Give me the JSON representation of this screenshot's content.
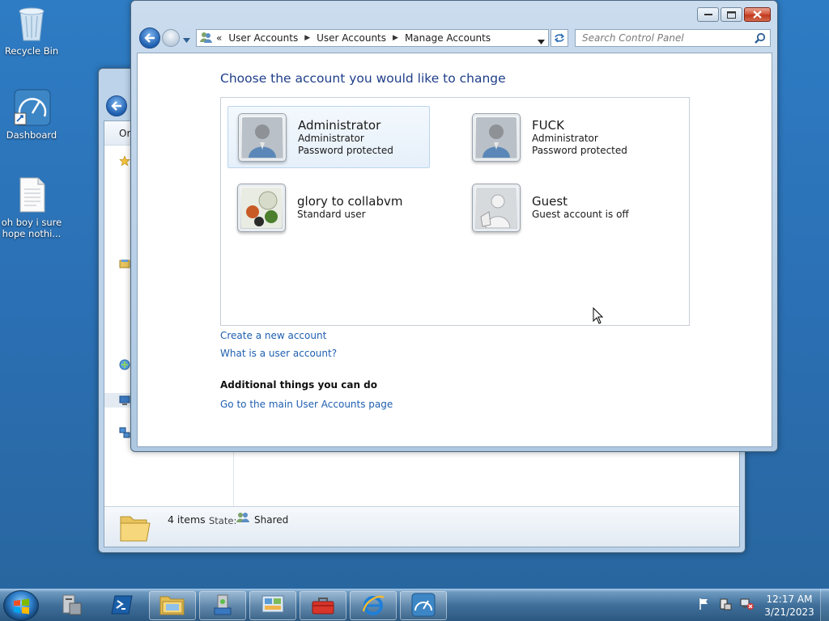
{
  "desktop": {
    "icons": [
      {
        "label": "Recycle Bin",
        "icon": "recycle-bin-icon"
      },
      {
        "label": "Dashboard",
        "icon": "dashboard-shortcut-icon"
      },
      {
        "label": "oh boy i sure hope nothi...",
        "icon": "text-document-icon"
      }
    ]
  },
  "back_window": {
    "nav_partial": "Or",
    "status": {
      "count": "4 items",
      "state_label": "State:",
      "state_value": "Shared"
    }
  },
  "window": {
    "breadcrumb": {
      "overflow": "«",
      "items": [
        "User Accounts",
        "User Accounts",
        "Manage Accounts"
      ]
    },
    "search_placeholder": "Search Control Panel",
    "heading": "Choose the account you would like to change",
    "accounts": [
      {
        "name": "Administrator",
        "line1": "Administrator",
        "line2": "Password protected",
        "picture": "default-user-icon",
        "selected": true
      },
      {
        "name": "FUCK",
        "line1": "Administrator",
        "line2": "Password protected",
        "picture": "default-user-icon",
        "selected": false
      },
      {
        "name": "glory to collabvm",
        "line1": "Standard user",
        "line2": "",
        "picture": "chess-pieces-icon",
        "selected": false
      },
      {
        "name": "Guest",
        "line1": "Guest account is off",
        "line2": "",
        "picture": "guest-user-icon",
        "selected": false
      }
    ],
    "links": {
      "create": "Create a new account",
      "what_is": "What is a user account?",
      "additional_heading": "Additional things you can do",
      "main_page": "Go to the main User Accounts page"
    }
  },
  "taskbar": {
    "clock": {
      "time": "12:17 AM",
      "date": "3/21/2023"
    },
    "buttons": [
      "server-manager-icon",
      "powershell-icon",
      "windows-explorer-icon",
      "network-share-icon",
      "control-panel-icon",
      "toolbox-icon",
      "internet-explorer-icon",
      "dashboard-icon"
    ]
  },
  "colors": {
    "accent": "#1f5fb0",
    "heading": "#1e3e8a",
    "desktop": "#2b6fb3"
  }
}
